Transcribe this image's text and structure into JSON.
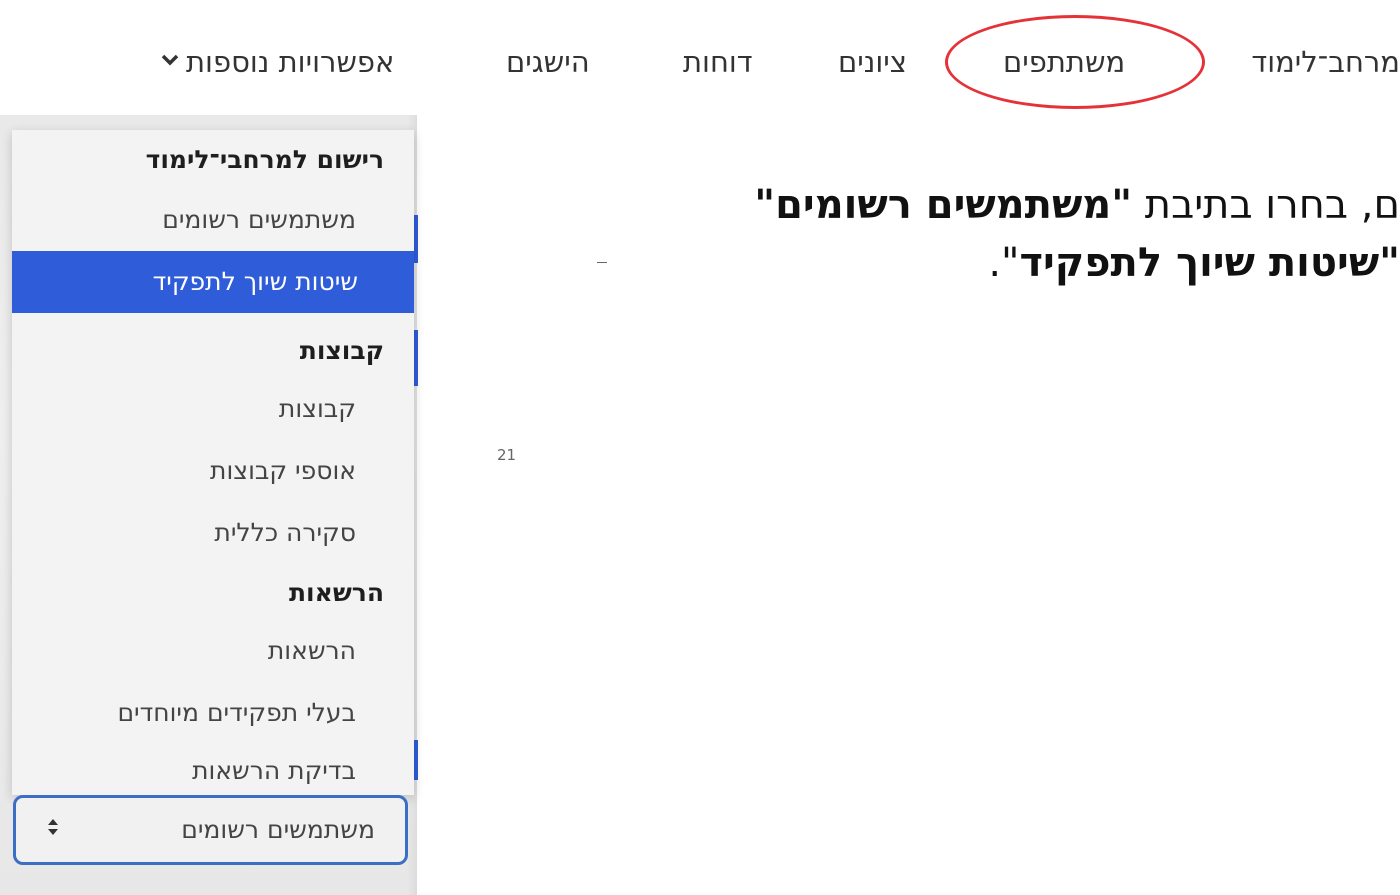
{
  "nav": {
    "items": [
      "מרחב־לימוד",
      "משתתפים",
      "ציונים",
      "דוחות",
      "הישגים"
    ],
    "more_label": "אפשרויות נוספות",
    "more_icon": "chevron-down-icon",
    "highlight_color": "#e53238"
  },
  "dropdown": {
    "group_1": "רישום למרחבי־לימוד",
    "option_registered": "משתמשים רשומים",
    "option_enrolment": "שיטות שיוך לתפקיד",
    "group_2": "קבוצות",
    "option_groups": "קבוצות",
    "option_groupings": "אוספי קבוצות",
    "option_overview": "סקירה כללית",
    "group_3": "הרשאות",
    "option_permissions": "הרשאות",
    "option_other_users": "בעלי תפקידים מיוחדים",
    "option_check": "בדיקת הרשאות",
    "selected_color": "#2f5cd8"
  },
  "select": {
    "value": "משתמשים רשומים",
    "icon": "updown-arrows-icon"
  },
  "instruction": {
    "line1_prefix": "ם, בחרו בתיבת ",
    "line1_bold": "\"משתמשים רשומים\"",
    "line2_bold": "\"שיטות שיוך לתפקיד",
    "line2_suffix": "\"."
  },
  "page_number": "21"
}
